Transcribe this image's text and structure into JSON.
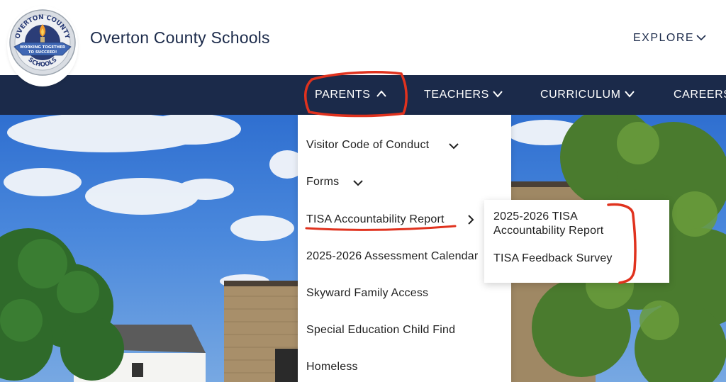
{
  "header": {
    "site_title": "Overton County Schools",
    "explore_label": "EXPLORE",
    "logo": {
      "top_text": "OVERTON COUNTY",
      "ribbon_text_1": "WORKING TOGETHER",
      "ribbon_text_2": "TO SUCCEED!",
      "bottom_text": "SCHOOLS"
    }
  },
  "nav": {
    "items": [
      {
        "label": "PARENTS",
        "state": "expanded"
      },
      {
        "label": "TEACHERS"
      },
      {
        "label": "CURRICULUM"
      },
      {
        "label": "CAREERS"
      }
    ]
  },
  "dropdown": {
    "items": [
      {
        "label": "Visitor Code of Conduct"
      },
      {
        "label": "Forms"
      },
      {
        "label": "TISA Accountability Report"
      },
      {
        "label": "2025-2026 Assessment Calendar"
      },
      {
        "label": "Skyward Family Access"
      },
      {
        "label": "Special Education Child Find"
      },
      {
        "label": "Homeless"
      }
    ]
  },
  "submenu": {
    "items": [
      {
        "label_line1": "2025-2026 TISA",
        "label_line2": "Accountability Report"
      },
      {
        "label": "TISA Feedback Survey"
      }
    ]
  },
  "colors": {
    "navy": "#1b2a4a",
    "annotation_red": "#e0321e",
    "hero_sky": "#3f7fd8"
  },
  "icons": [
    "chevron-down-icon",
    "chevron-up-icon",
    "chevron-right-icon",
    "school-logo"
  ]
}
